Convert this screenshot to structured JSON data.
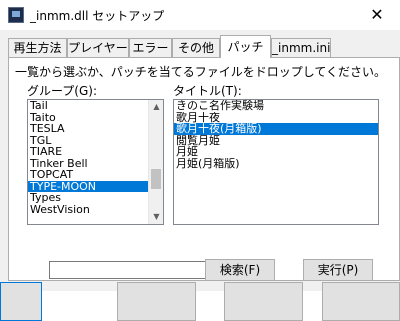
{
  "window": {
    "title": "_inmm.dll セットアップ",
    "icon": "app-icon",
    "close_glyph": "✕"
  },
  "tabs": [
    {
      "label": "再生方法",
      "active": false
    },
    {
      "label": "プレイヤー",
      "active": false
    },
    {
      "label": "エラー",
      "active": false
    },
    {
      "label": "その他",
      "active": false
    },
    {
      "label": "パッチ",
      "active": true
    },
    {
      "label": "_inmm.ini",
      "active": false
    }
  ],
  "patch": {
    "instruction": "一覧から選ぶか、パッチを当てるファイルをドロップしてください。",
    "group_label": "グループ(G):",
    "title_label": "タイトル(T):",
    "groups": [
      "Tail",
      "Taito",
      "TESLA",
      "TGL",
      "TIARE",
      "Tinker Bell",
      "TOPCAT",
      "TYPE-MOON",
      "Types",
      "WestVision"
    ],
    "group_selected_index": 7,
    "group_scroll_fraction": 0.72,
    "titles": [
      "きのこ名作実験場",
      "歌月十夜",
      "歌月十夜(月箱版)",
      "閲覧月姫",
      "月姫",
      "月姫(月箱版)"
    ],
    "title_selected_index": 2,
    "search_value": "",
    "search_button": "検索(F)",
    "run_button": "実行(P)"
  },
  "colors": {
    "selection": "#0078d7",
    "dialog_bg": "#f0f0f0"
  }
}
